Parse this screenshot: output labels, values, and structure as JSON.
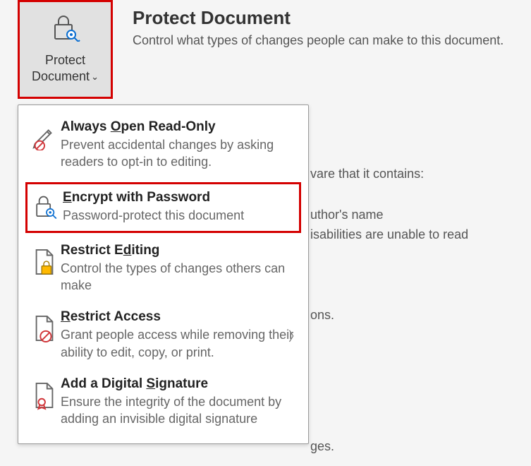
{
  "header": {
    "title": "Protect Document",
    "subtitle": "Control what types of changes people can make to this document."
  },
  "button": {
    "line1": "Protect",
    "line2": "Document"
  },
  "bg_text": {
    "l1": "vare that it contains:",
    "l2": "uthor's name",
    "l3": "isabilities are unable to read",
    "l4": "ons.",
    "l5": "ges."
  },
  "menu": {
    "read_only": {
      "title_pre": "Always ",
      "title_u": "O",
      "title_post": "pen Read-Only",
      "desc": "Prevent accidental changes by asking readers to opt-in to editing."
    },
    "encrypt": {
      "title_u": "E",
      "title_post": "ncrypt with Password",
      "desc": "Password-protect this document"
    },
    "restrict_edit": {
      "title_pre": "Restrict E",
      "title_u": "d",
      "title_post": "iting",
      "desc": "Control the types of changes others can make"
    },
    "restrict_access": {
      "title_u": "R",
      "title_post": "estrict Access",
      "desc": "Grant people access while removing their ability to edit, copy, or print."
    },
    "signature": {
      "title_pre": "Add a Digital ",
      "title_u": "S",
      "title_post": "ignature",
      "desc": "Ensure the integrity of the document by adding an invisible digital signature"
    }
  }
}
